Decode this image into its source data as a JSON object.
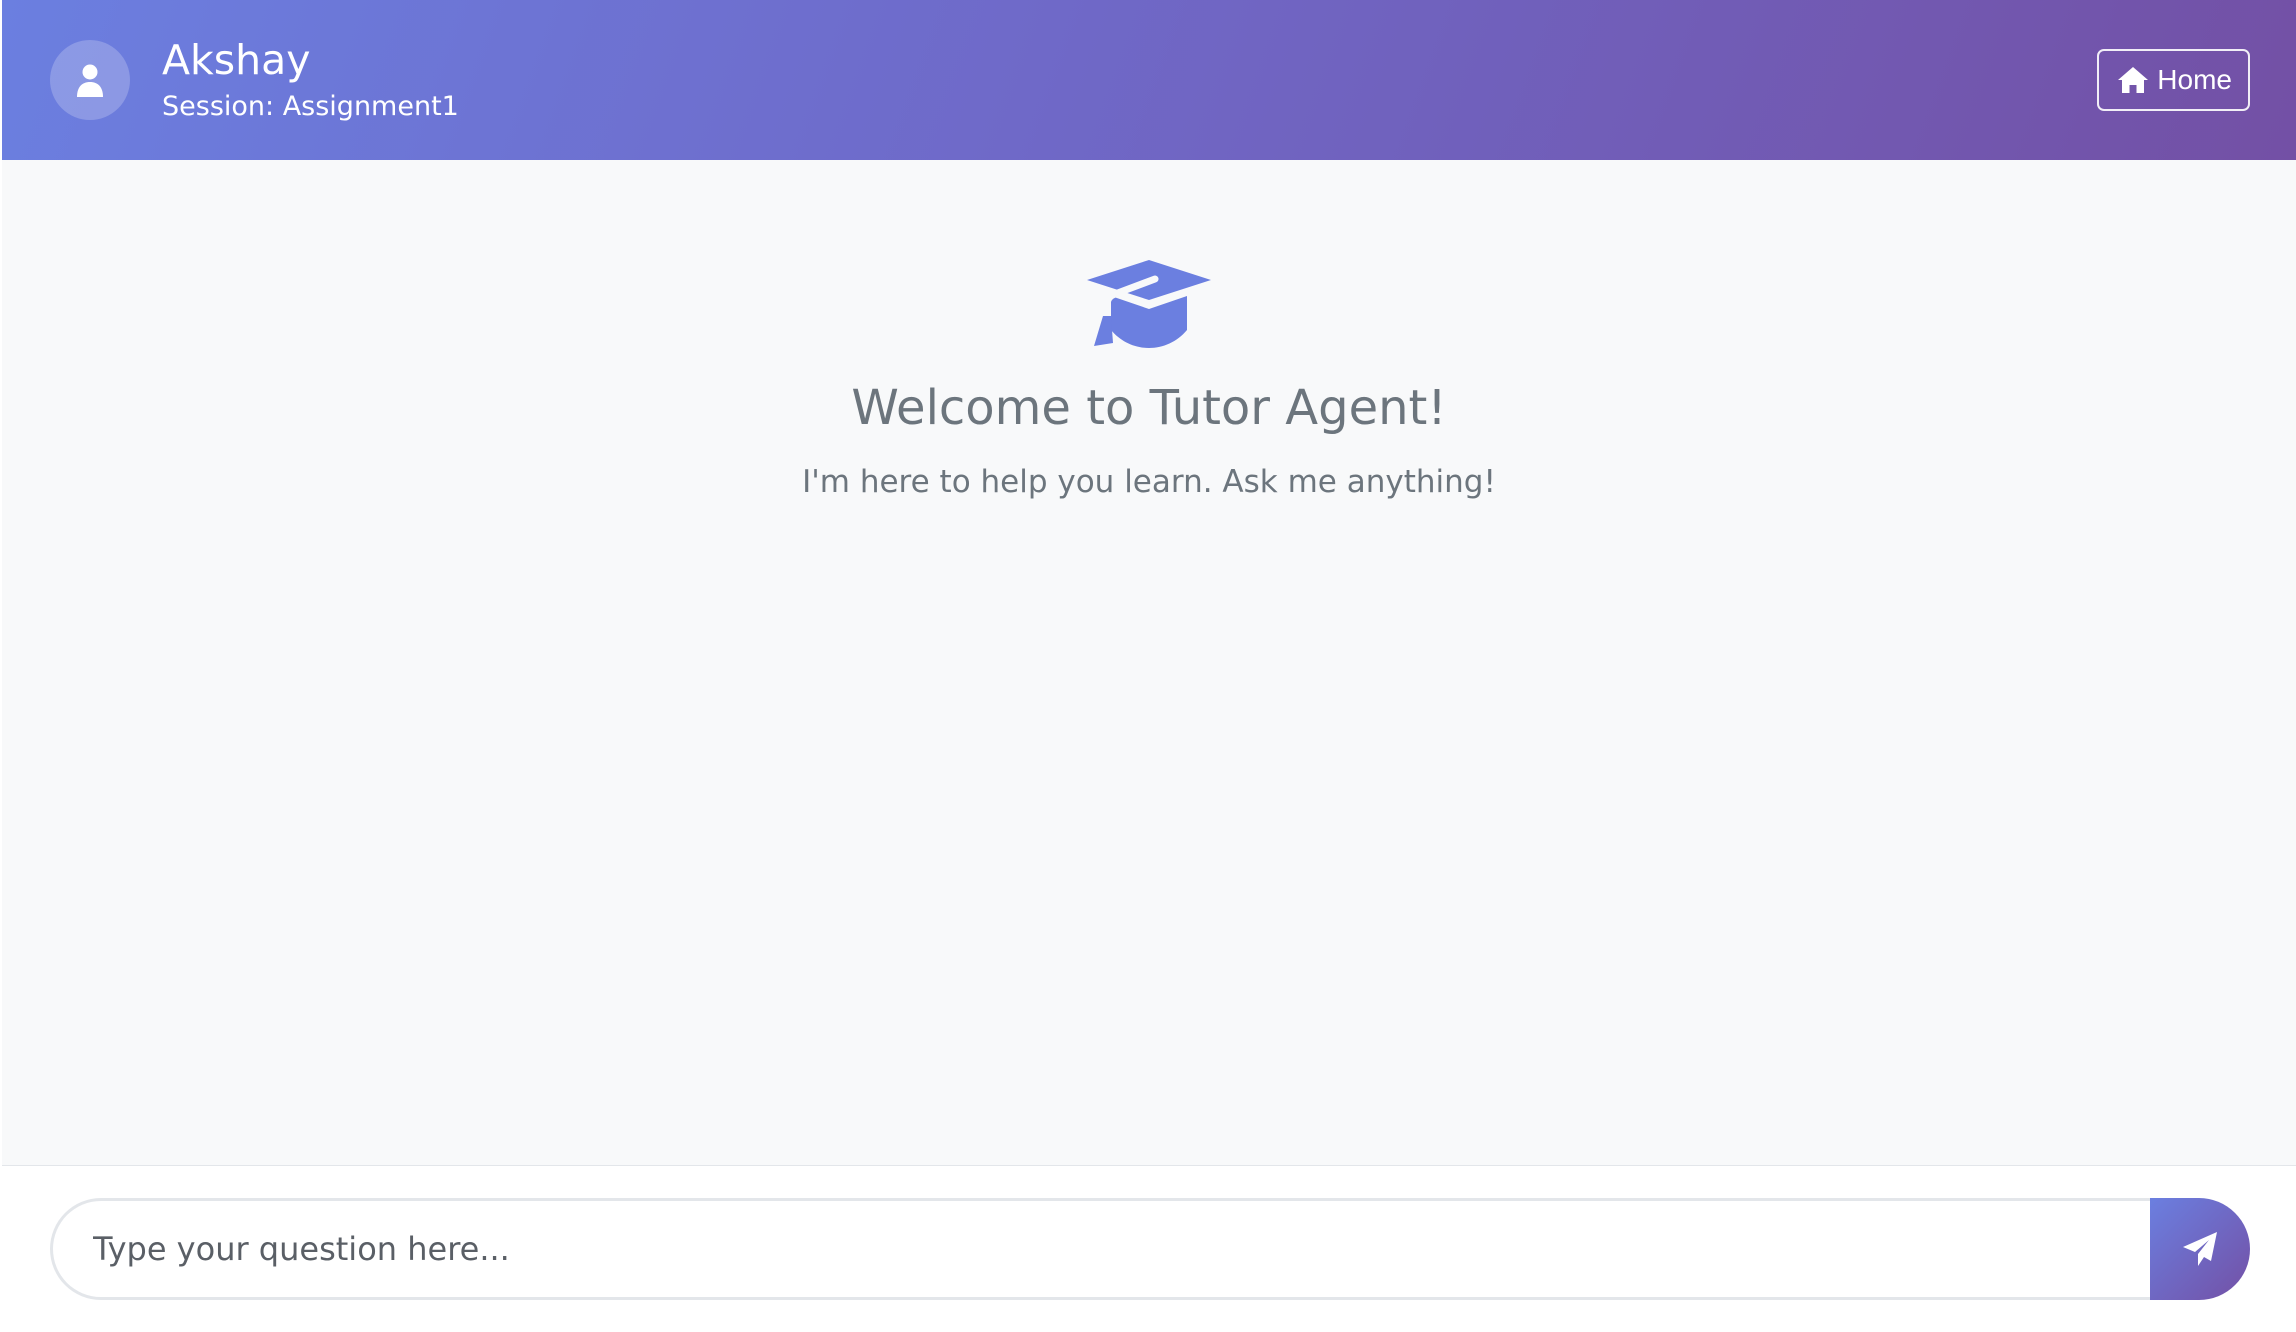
{
  "header": {
    "user_name": "Akshay",
    "session_label": "Session: Assignment1",
    "home_label": "Home"
  },
  "welcome": {
    "icon": "graduation-cap-icon",
    "title": "Welcome to Tutor Agent!",
    "subtitle": "I'm here to help you learn. Ask me anything!"
  },
  "composer": {
    "placeholder": "Type your question here...",
    "value": "",
    "send_icon": "paper-plane-icon"
  },
  "colors": {
    "accent": "#6b7fe0",
    "accent_dark": "#7350a5",
    "muted_text": "#6c757d"
  }
}
